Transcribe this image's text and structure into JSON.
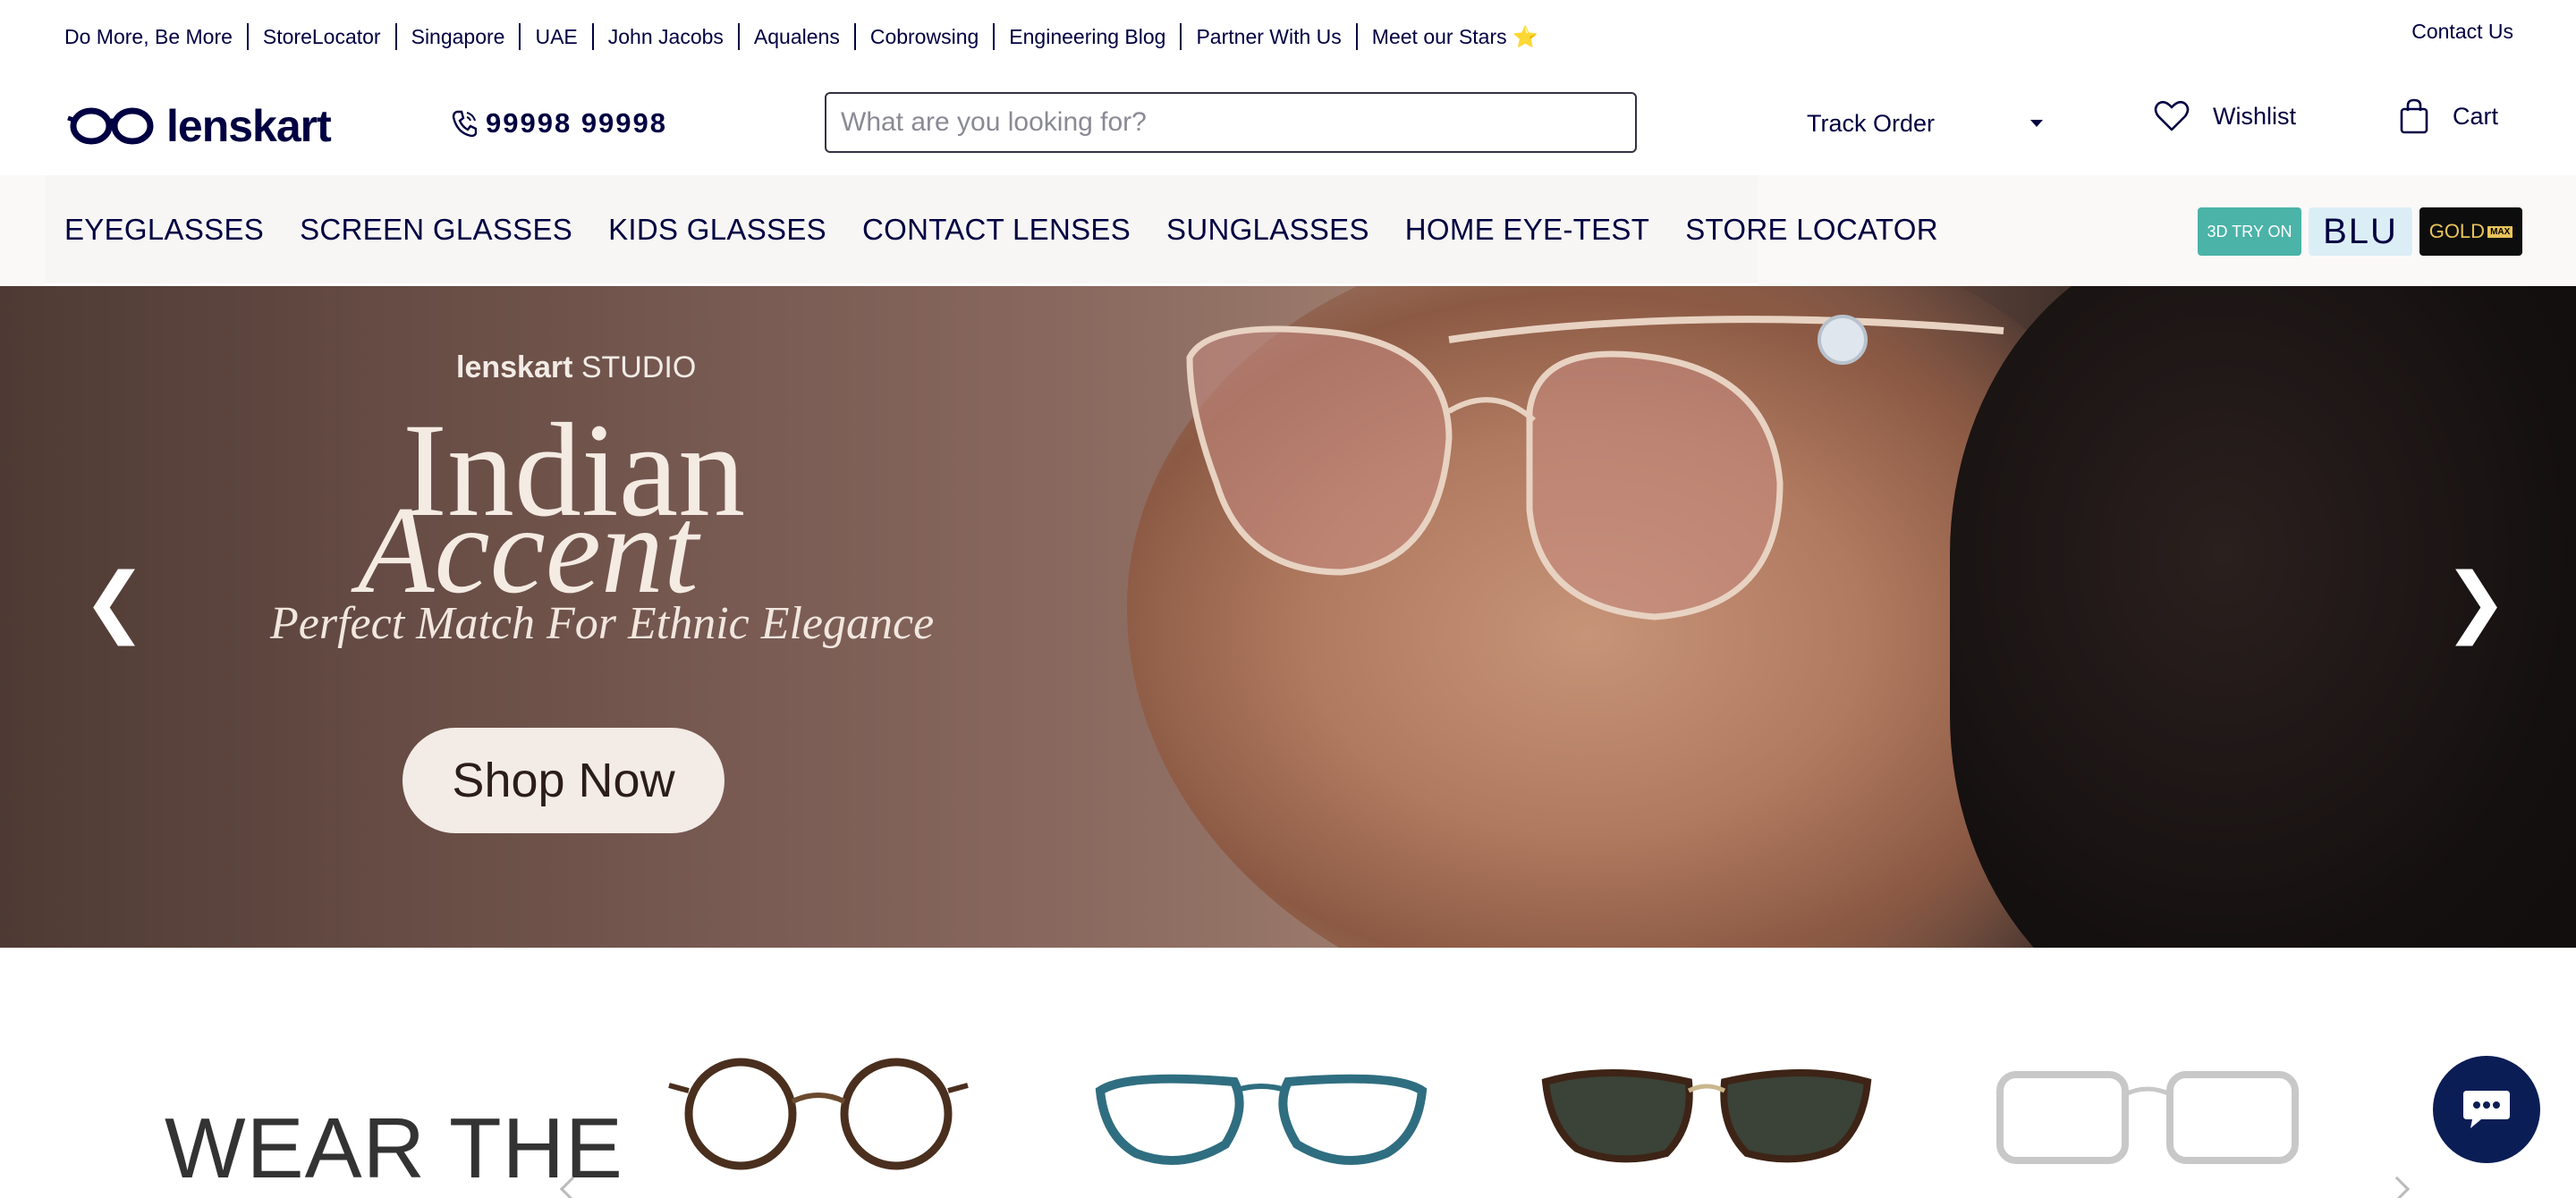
{
  "top_links": [
    "Do More, Be More",
    "StoreLocator",
    "Singapore",
    "UAE",
    "John Jacobs",
    "Aqualens",
    "Cobrowsing",
    "Engineering Blog",
    "Partner With Us",
    "Meet our Stars ⭐"
  ],
  "contact_label": "Contact Us",
  "logo_text": "lenskart",
  "phone": "99998 99998",
  "search": {
    "placeholder": "What are you looking for?"
  },
  "track_order": "Track Order",
  "wishlist": "Wishlist",
  "cart": "Cart",
  "nav_links": [
    "EYEGLASSES",
    "SCREEN GLASSES",
    "KIDS GLASSES",
    "CONTACT LENSES",
    "SUNGLASSES",
    "HOME EYE-TEST",
    "STORE LOCATOR"
  ],
  "badges": {
    "try_on": "3D TRY ON",
    "blu": "BLU",
    "gold": "GOLD",
    "gold_max": "MAX"
  },
  "hero": {
    "brand": "lenskart",
    "brand_suffix": "STUDIO",
    "title_line1": "Indian",
    "title_line2": "Accent",
    "tagline": "Perfect Match For Ethnic Elegance",
    "cta": "Shop Now",
    "prev": "❮",
    "next": "❯"
  },
  "section_heading": "WEAR THE",
  "colors": {
    "brand_navy": "#000042",
    "teal": "#4bb3a8",
    "chat_bg": "#0a1d55"
  },
  "icons": [
    "phone-icon",
    "heart-icon",
    "bag-icon",
    "chat-icon"
  ]
}
